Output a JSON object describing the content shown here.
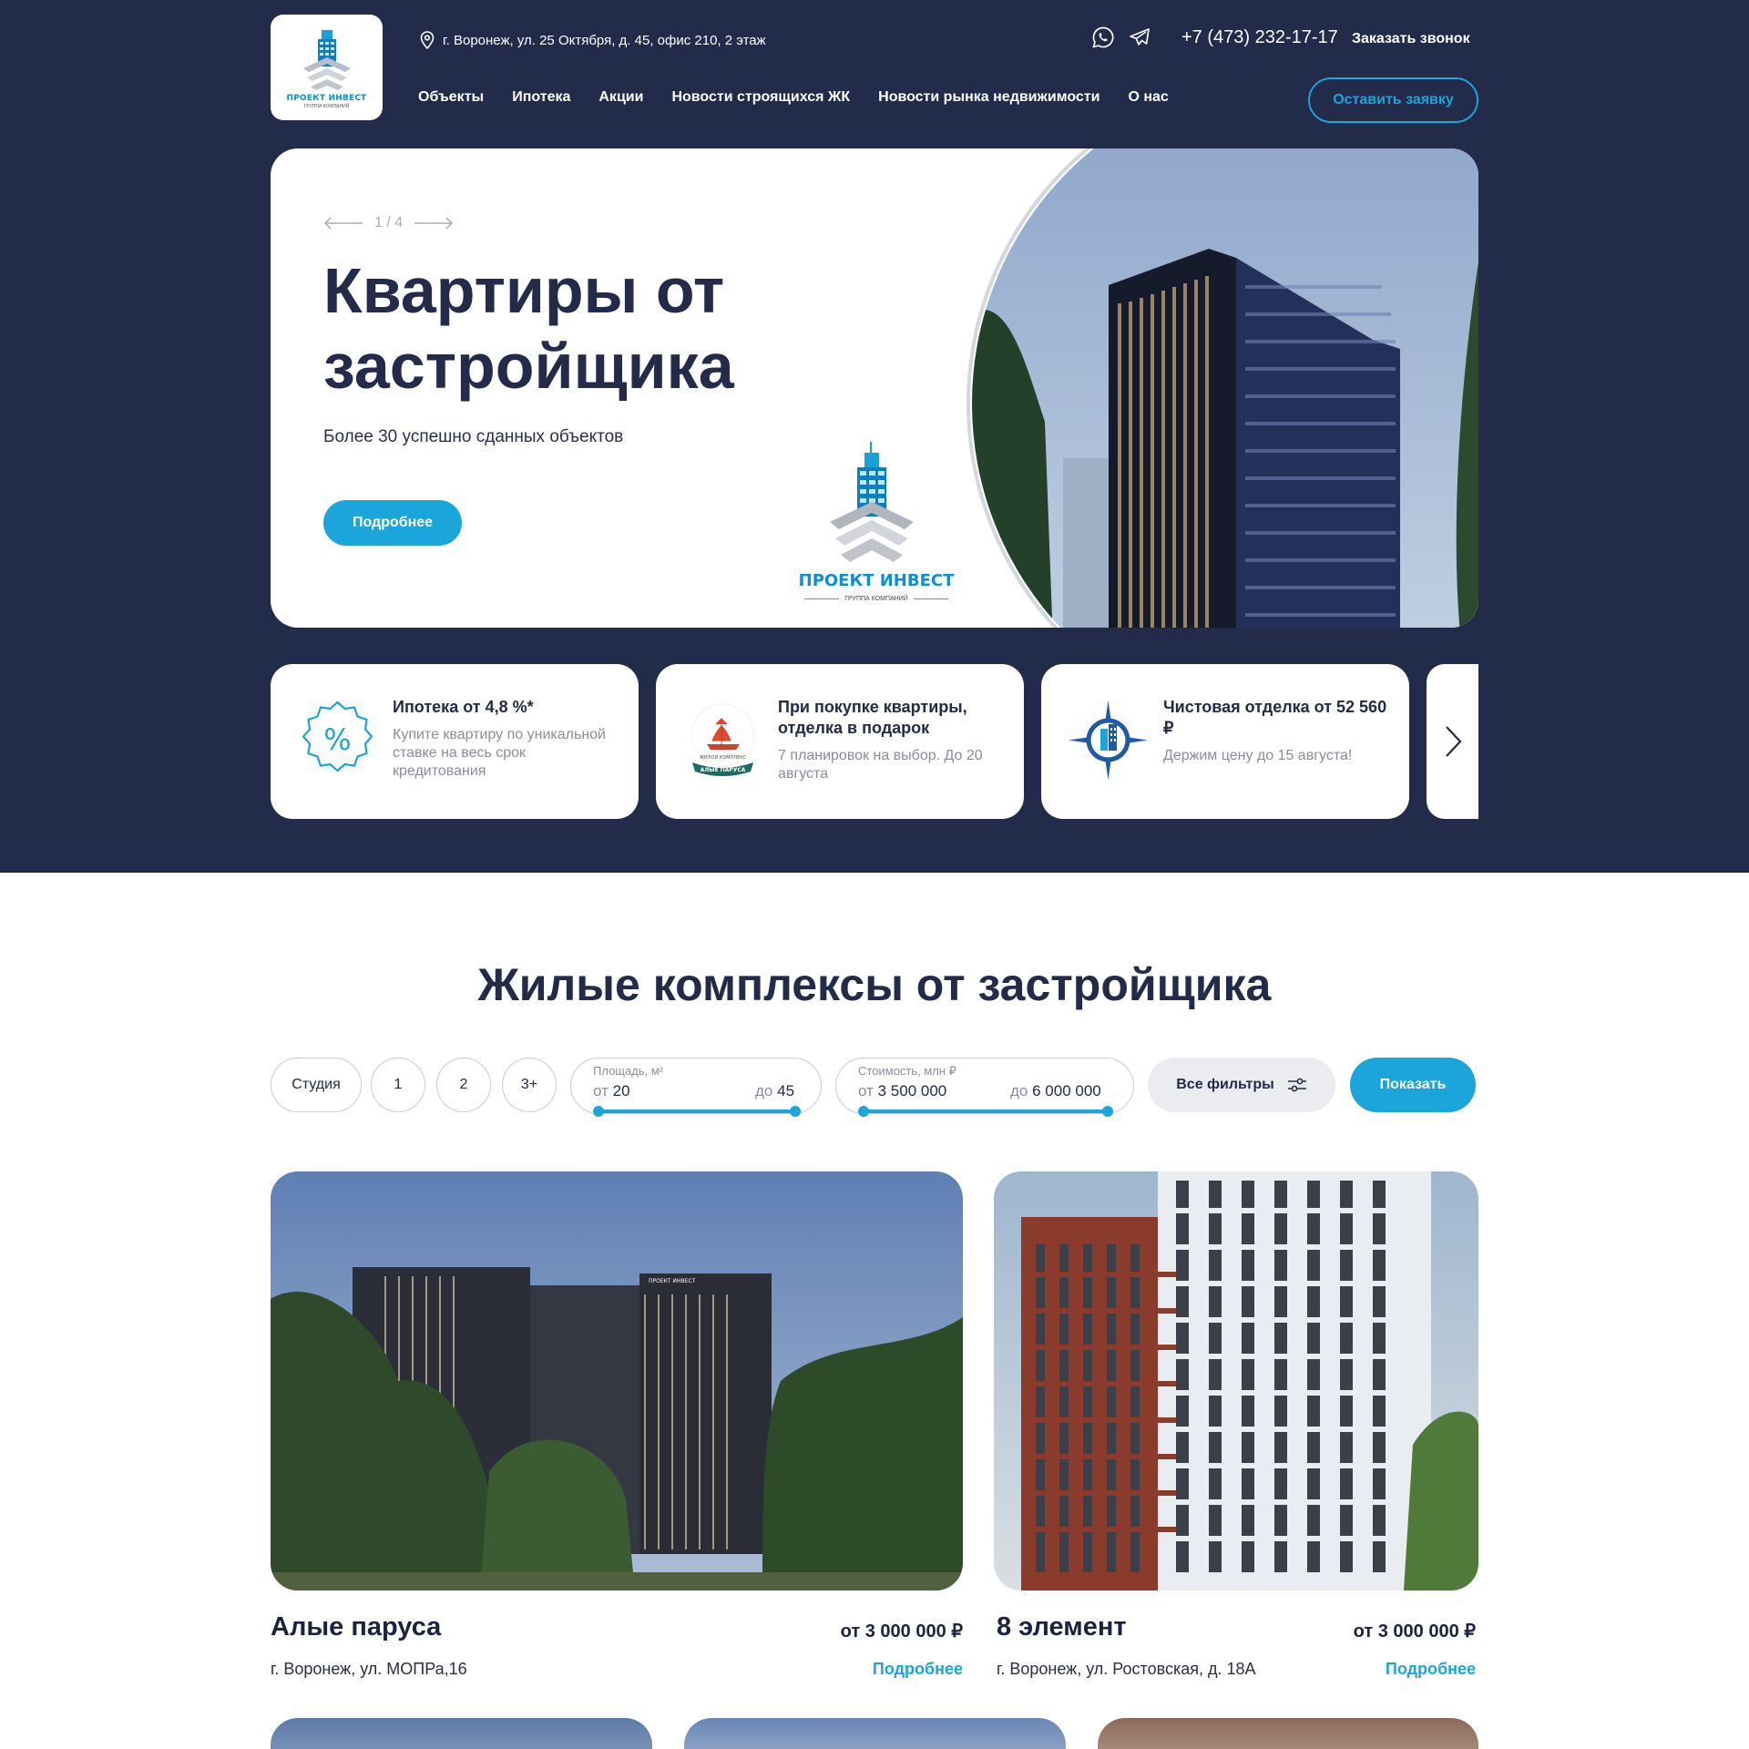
{
  "header": {
    "logo_text": "ПРОЕКТ ИНВЕСТ",
    "logo_sub": "ГРУППА КОМПАНИЙ",
    "address": "г. Воронеж, ул. 25 Октября, д. 45, офис 210, 2 этаж",
    "phone": "+7 (473) 232-17-17",
    "callback": "Заказать звонок",
    "nav": [
      "Объекты",
      "Ипотека",
      "Акции",
      "Новости строящихся ЖК",
      "Новости рынка недвижимости",
      "О нас"
    ],
    "apply_label": "Оставить заявку"
  },
  "hero": {
    "slide_counter": "1 / 4",
    "title": "Квартиры от застройщика",
    "subtitle": "Более 30 успешно сданных объектов",
    "button": "Подробнее",
    "logo_text": "ПРОЕКТ ИНВЕСТ",
    "logo_sub": "ГРУППА КОМПАНИЙ"
  },
  "promos": [
    {
      "title": "Ипотека от 4,8 %*",
      "text": "Купите квартиру по уникальной ставке на весь срок кредитования",
      "icon": "percent-icon"
    },
    {
      "title": "При покупке квартиры, отделка в подарок",
      "text": "7 планировок на выбор. До 20 августа",
      "icon": "alye-parusa-logo",
      "badge_text": "АЛЫЕ ПАРУСА",
      "badge_sub": "ЖИЛОЙ КОМПЛЕКС"
    },
    {
      "title": "Чистовая отделка от 52 560 ₽",
      "text": "Держим цену до 15 августа!",
      "icon": "compass-building-logo"
    }
  ],
  "section": {
    "title": "Жилые комплексы от застройщика"
  },
  "filters": {
    "rooms": [
      "Студия",
      "1",
      "2",
      "3+"
    ],
    "area": {
      "label": "Площадь, м²",
      "from_prefix": "от",
      "from": "20",
      "to_prefix": "до",
      "to": "45"
    },
    "price": {
      "label": "Стоимость, млн ₽",
      "from_prefix": "от",
      "from": "3 500 000",
      "to_prefix": "до",
      "to": "6 000 000"
    },
    "all_filters": "Все фильтры",
    "show": "Показать"
  },
  "objects": [
    {
      "name": "Алые паруса",
      "price": "от 3 000 000 ₽",
      "address": "г. Воронеж, ул. МОПРа,16",
      "more": "Подробнее",
      "sign": "ПРОЕКТ ИНВЕСТ"
    },
    {
      "name": "8 элемент",
      "price": "от 3 000 000 ₽",
      "address": "г. Воронеж, ул. Ростовская, д. 18А",
      "more": "Подробнее"
    }
  ],
  "colors": {
    "navy": "#232b4b",
    "accent": "#1aa6da",
    "text": "#232a4a"
  }
}
